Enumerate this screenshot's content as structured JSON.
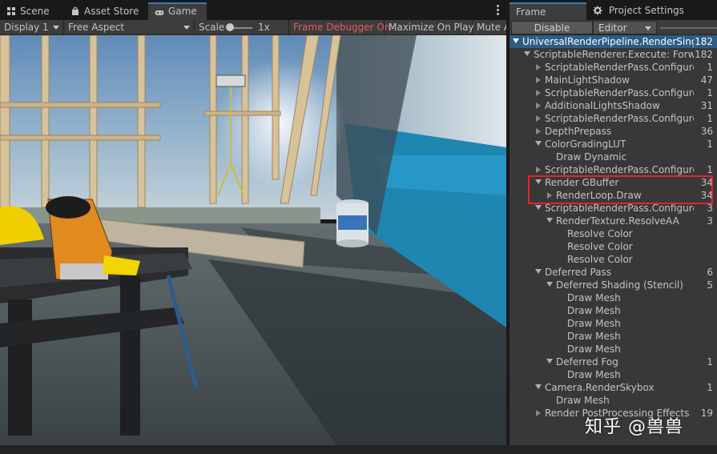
{
  "left_tabs": [
    {
      "label": "Scene",
      "icon": "grid-icon"
    },
    {
      "label": "Asset Store",
      "icon": "bag-icon"
    },
    {
      "label": "Game",
      "icon": "gamepad-icon",
      "active": true
    }
  ],
  "game_toolbar": {
    "display": "Display 1",
    "aspect": "Free Aspect",
    "scale_label": "Scale",
    "scale_value": "1x",
    "frame_debugger": "Frame Debugger On",
    "maximize": "Maximize On Play",
    "mute": "Mute Audio"
  },
  "right_tabs": [
    {
      "label": "Frame Debug",
      "active": true
    },
    {
      "label": "Project Settings",
      "icon": "gear-icon"
    }
  ],
  "debug_toolbar": {
    "disable": "Disable",
    "target": "Editor"
  },
  "tree": [
    {
      "label": "UniversalRenderPipeline.RenderSingleCamera",
      "count": "182",
      "depth": 0,
      "fold": "open",
      "selected": true
    },
    {
      "label": "ScriptableRenderer.Execute: ForwardRenderer",
      "count": "182",
      "depth": 1,
      "fold": "open"
    },
    {
      "label": "ScriptableRenderPass.Configure",
      "count": "1",
      "depth": 2,
      "fold": "closed"
    },
    {
      "label": "MainLightShadow",
      "count": "47",
      "depth": 2,
      "fold": "closed"
    },
    {
      "label": "ScriptableRenderPass.Configure",
      "count": "1",
      "depth": 2,
      "fold": "closed"
    },
    {
      "label": "AdditionalLightsShadow",
      "count": "31",
      "depth": 2,
      "fold": "closed"
    },
    {
      "label": "ScriptableRenderPass.Configure",
      "count": "1",
      "depth": 2,
      "fold": "closed"
    },
    {
      "label": "DepthPrepass",
      "count": "36",
      "depth": 2,
      "fold": "closed"
    },
    {
      "label": "ColorGradingLUT",
      "count": "1",
      "depth": 2,
      "fold": "open"
    },
    {
      "label": "Draw Dynamic",
      "count": "",
      "depth": 3,
      "fold": "none"
    },
    {
      "label": "ScriptableRenderPass.Configure",
      "count": "1",
      "depth": 2,
      "fold": "closed"
    },
    {
      "label": "Render GBuffer",
      "count": "34",
      "depth": 2,
      "fold": "open"
    },
    {
      "label": "RenderLoop.Draw",
      "count": "34",
      "depth": 3,
      "fold": "closed"
    },
    {
      "label": "ScriptableRenderPass.Configure",
      "count": "3",
      "depth": 2,
      "fold": "open"
    },
    {
      "label": "RenderTexture.ResolveAA",
      "count": "3",
      "depth": 3,
      "fold": "open"
    },
    {
      "label": "Resolve Color",
      "count": "",
      "depth": 4,
      "fold": "none"
    },
    {
      "label": "Resolve Color",
      "count": "",
      "depth": 4,
      "fold": "none"
    },
    {
      "label": "Resolve Color",
      "count": "",
      "depth": 4,
      "fold": "none"
    },
    {
      "label": "Deferred Pass",
      "count": "6",
      "depth": 2,
      "fold": "open"
    },
    {
      "label": "Deferred Shading (Stencil)",
      "count": "5",
      "depth": 3,
      "fold": "open"
    },
    {
      "label": "Draw Mesh",
      "count": "",
      "depth": 4,
      "fold": "none"
    },
    {
      "label": "Draw Mesh",
      "count": "",
      "depth": 4,
      "fold": "none"
    },
    {
      "label": "Draw Mesh",
      "count": "",
      "depth": 4,
      "fold": "none"
    },
    {
      "label": "Draw Mesh",
      "count": "",
      "depth": 4,
      "fold": "none"
    },
    {
      "label": "Draw Mesh",
      "count": "",
      "depth": 4,
      "fold": "none"
    },
    {
      "label": "Deferred Fog",
      "count": "1",
      "depth": 3,
      "fold": "open"
    },
    {
      "label": "Draw Mesh",
      "count": "",
      "depth": 4,
      "fold": "none"
    },
    {
      "label": "Camera.RenderSkybox",
      "count": "1",
      "depth": 2,
      "fold": "open"
    },
    {
      "label": "Draw Mesh",
      "count": "",
      "depth": 3,
      "fold": "none"
    },
    {
      "label": "Render PostProcessing Effects",
      "count": "19",
      "depth": 2,
      "fold": "closed"
    }
  ],
  "watermark": "知乎 @兽兽",
  "colors": {
    "accent": "#3a79bb",
    "selection": "#2c5d87",
    "highlight_box": "#e0262e",
    "frame_debugger_on": "#e05b5b"
  }
}
